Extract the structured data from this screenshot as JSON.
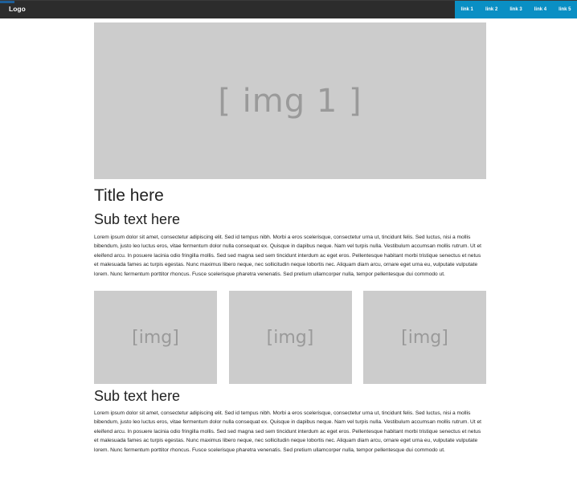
{
  "navbar": {
    "logo": "Logo",
    "links": [
      "link 1",
      "link 2",
      "link 3",
      "link 4",
      "link 5"
    ],
    "accent_color": "#0a8fc4",
    "background_color": "#2c2c2c"
  },
  "hero": {
    "placeholder": "[ img 1 ]"
  },
  "content": {
    "title": "Title here",
    "section1": {
      "subtitle": "Sub text here",
      "body": "Lorem ipsum dolor sit amet, consectetur adipiscing elit. Sed id tempus nibh. Morbi a eros scelerisque, consectetur urna ut, tincidunt felis. Sed luctus, nisi a mollis bibendum, justo leo luctus eros, vitae fermentum dolor nulla consequat ex. Quisque in dapibus neque. Nam vel turpis nulla. Vestibulum accumsan mollis rutrum. Ut et eleifend arcu. In posuere lacinia odio fringilla mollis. Sed sed magna sed sem tincidunt interdum ac eget eros. Pellentesque habitant morbi tristique senectus et netus et malesuada fames ac turpis egestas. Nunc maximus libero neque, nec sollicitudin neque lobortis nec. Aliquam diam arcu, ornare eget urna eu, vulputate vulputate lorem. Nunc fermentum porttitor rhoncus. Fusce scelerisque pharetra venenatis. Sed pretium ullamcorper nulla, tempor pellentesque dui commodo ut."
    },
    "thumbnails": [
      "[img]",
      "[img]",
      "[img]"
    ],
    "section2": {
      "subtitle": "Sub text here",
      "body": "Lorem ipsum dolor sit amet, consectetur adipiscing elit. Sed id tempus nibh. Morbi a eros scelerisque, consectetur urna ut, tincidunt felis. Sed luctus, nisi a mollis bibendum, justo leo luctus eros, vitae fermentum dolor nulla consequat ex. Quisque in dapibus neque. Nam vel turpis nulla. Vestibulum accumsan mollis rutrum. Ut et eleifend arcu. In posuere lacinia odio fringilla mollis. Sed sed magna sed sem tincidunt interdum ac eget eros. Pellentesque habitant morbi tristique senectus et netus et malesuada fames ac turpis egestas. Nunc maximus libero neque, nec sollicitudin neque lobortis nec. Aliquam diam arcu, ornare eget urna eu, vulputate vulputate lorem. Nunc fermentum porttitor rhoncus. Fusce scelerisque pharetra venenatis. Sed pretium ullamcorper nulla, tempor pellentesque dui commodo ut."
    }
  }
}
